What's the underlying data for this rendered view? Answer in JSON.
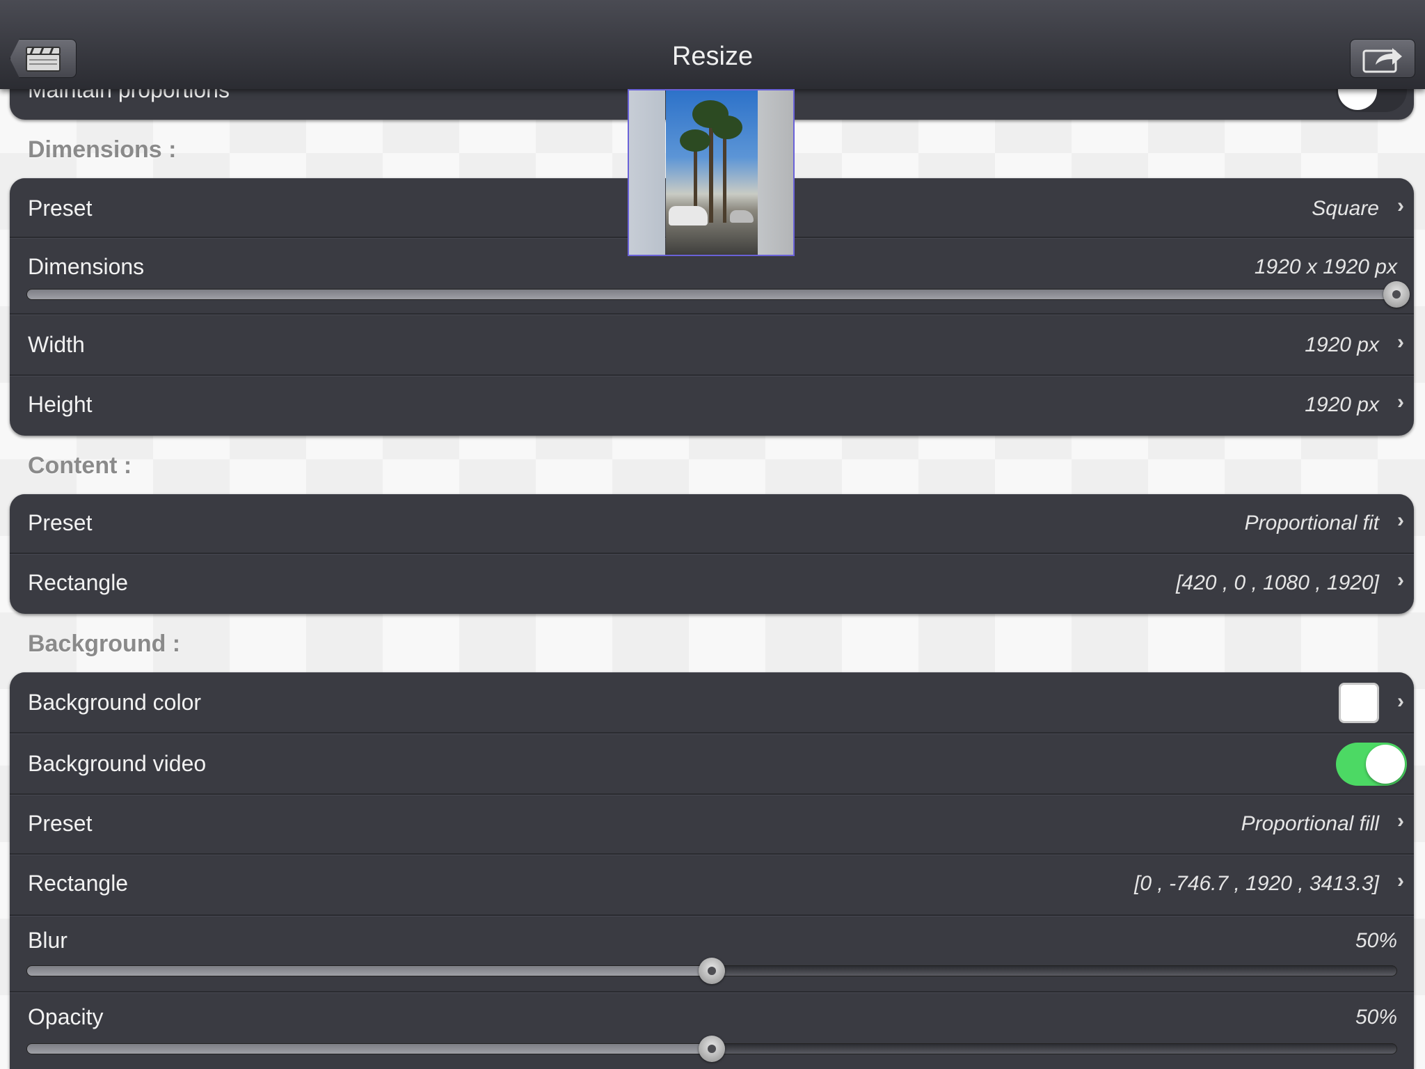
{
  "nav": {
    "title": "Resize"
  },
  "top_group": {
    "label": "Maintain proportions"
  },
  "dimensions": {
    "header": "Dimensions :",
    "rows": [
      {
        "label": "Preset",
        "value": "Square"
      },
      {
        "label": "Dimensions",
        "value": "1920 x 1920 px",
        "slider_value": 1.0
      },
      {
        "label": "Width",
        "value": "1920 px"
      },
      {
        "label": "Height",
        "value": "1920 px"
      }
    ]
  },
  "content": {
    "header": "Content :",
    "rows": [
      {
        "label": "Preset",
        "value": "Proportional fit"
      },
      {
        "label": "Rectangle",
        "value": "[420 , 0 , 1080 , 1920]"
      }
    ]
  },
  "background": {
    "header": "Background :",
    "color_label": "Background color",
    "color_value": "#ffffff",
    "video_label": "Background video",
    "video_on": true,
    "preset_label": "Preset",
    "preset_value": "Proportional fill",
    "rect_label": "Rectangle",
    "rect_value": "[0 , -746.7 , 1920 , 3413.3]",
    "blur_label": "Blur",
    "blur_value": "50%",
    "blur_fraction": 0.5,
    "opacity_label": "Opacity",
    "opacity_value": "50%",
    "opacity_fraction": 0.5
  },
  "icons": {
    "back": "clapperboard-back-icon",
    "share": "share-icon",
    "chevron": "›"
  },
  "colors": {
    "toggle_on": "#4cd964",
    "row_background": "#3a3b42"
  }
}
